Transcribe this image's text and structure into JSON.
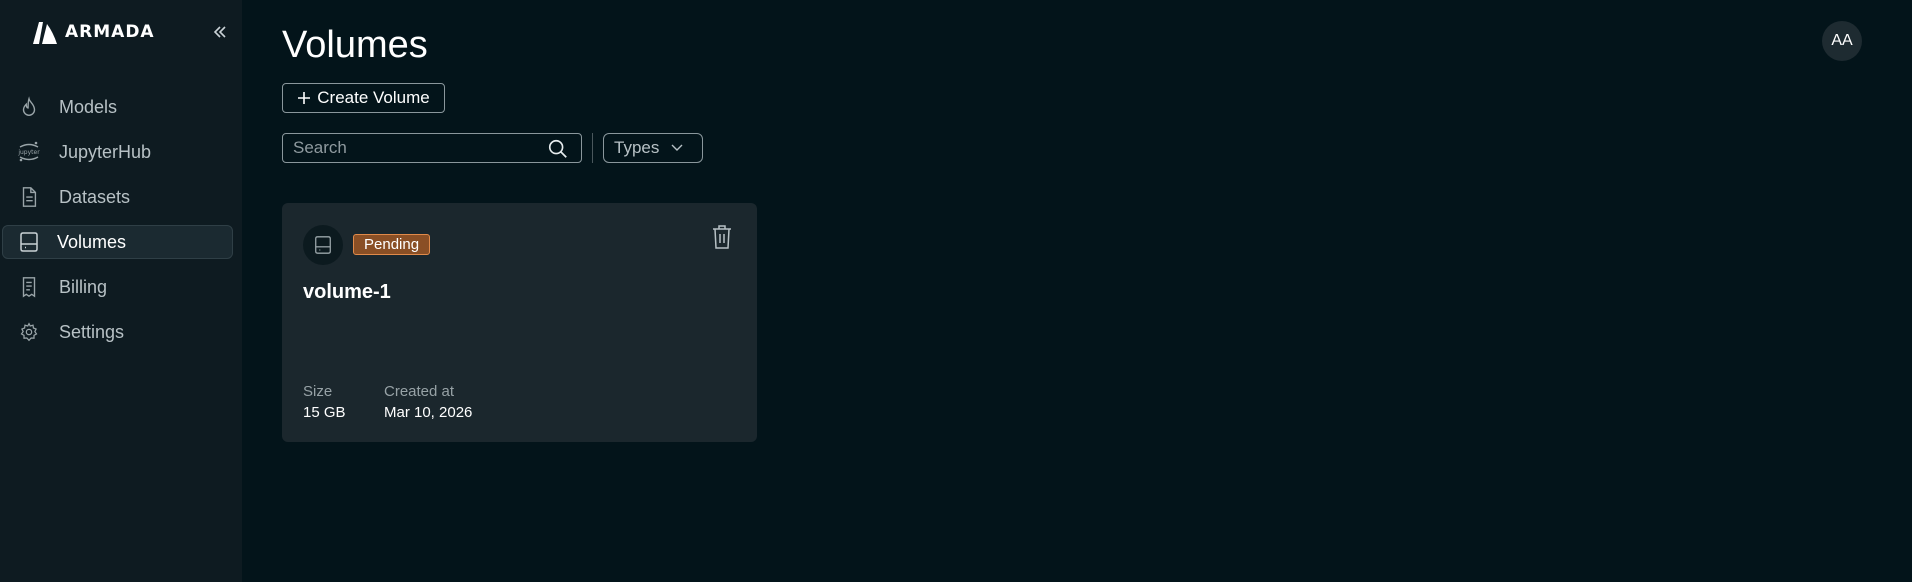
{
  "brand": {
    "name": "ARMADA"
  },
  "sidebar": {
    "items": [
      {
        "label": "Models",
        "icon": "flame-icon"
      },
      {
        "label": "JupyterHub",
        "icon": "jupyter-icon"
      },
      {
        "label": "Datasets",
        "icon": "document-icon"
      },
      {
        "label": "Volumes",
        "icon": "hard-drive-icon",
        "active": true
      },
      {
        "label": "Billing",
        "icon": "receipt-icon"
      },
      {
        "label": "Settings",
        "icon": "gear-icon"
      }
    ]
  },
  "header": {
    "title": "Volumes",
    "avatar_initials": "AA"
  },
  "toolbar": {
    "create_label": "Create Volume",
    "search_placeholder": "Search",
    "types_label": "Types"
  },
  "volumes": [
    {
      "name": "volume-1",
      "status": "Pending",
      "size_label": "Size",
      "size": "15 GB",
      "created_label": "Created at",
      "created": "Mar 10, 2026"
    }
  ],
  "colors": {
    "background": "#03141a",
    "sidebar": "#0e1b21",
    "card": "#1b272d",
    "pending_badge": "#8a4f25"
  }
}
